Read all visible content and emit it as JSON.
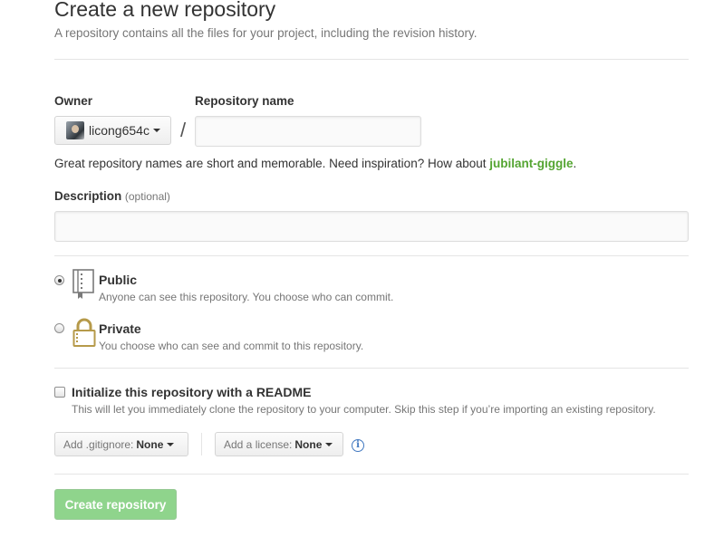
{
  "header": {
    "title": "Create a new repository",
    "subtitle": "A repository contains all the files for your project, including the revision history."
  },
  "owner": {
    "label": "Owner",
    "selected": "licong654c"
  },
  "repo_name": {
    "label": "Repository name",
    "separator": "/",
    "value": "",
    "placeholder": ""
  },
  "hint": {
    "text": "Great repository names are short and memorable. Need inspiration? How about ",
    "suggestion": "jubilant-giggle",
    "suffix": "."
  },
  "description": {
    "label": "Description",
    "optional": "(optional)",
    "value": "",
    "placeholder": ""
  },
  "visibility": {
    "selected": "public",
    "options": [
      {
        "id": "public",
        "title": "Public",
        "note": "Anyone can see this repository. You choose who can commit.",
        "icon": "repo-book-icon"
      },
      {
        "id": "private",
        "title": "Private",
        "note": "You choose who can see and commit to this repository.",
        "icon": "lock-icon"
      }
    ]
  },
  "init": {
    "checked": false,
    "label": "Initialize this repository with a README",
    "note": "This will let you immediately clone the repository to your computer. Skip this step if you’re importing an existing repository."
  },
  "gitignore": {
    "label": "Add .gitignore:",
    "value": "None"
  },
  "license": {
    "label": "Add a license:",
    "value": "None"
  },
  "info_icon": {
    "glyph": "i",
    "icon": "info-icon"
  },
  "submit": {
    "label": "Create repository"
  },
  "colors": {
    "suggestion": "#55a532",
    "submit_bg": "#8fd48c",
    "info": "#4078c0",
    "lock": "#b69a4a"
  }
}
